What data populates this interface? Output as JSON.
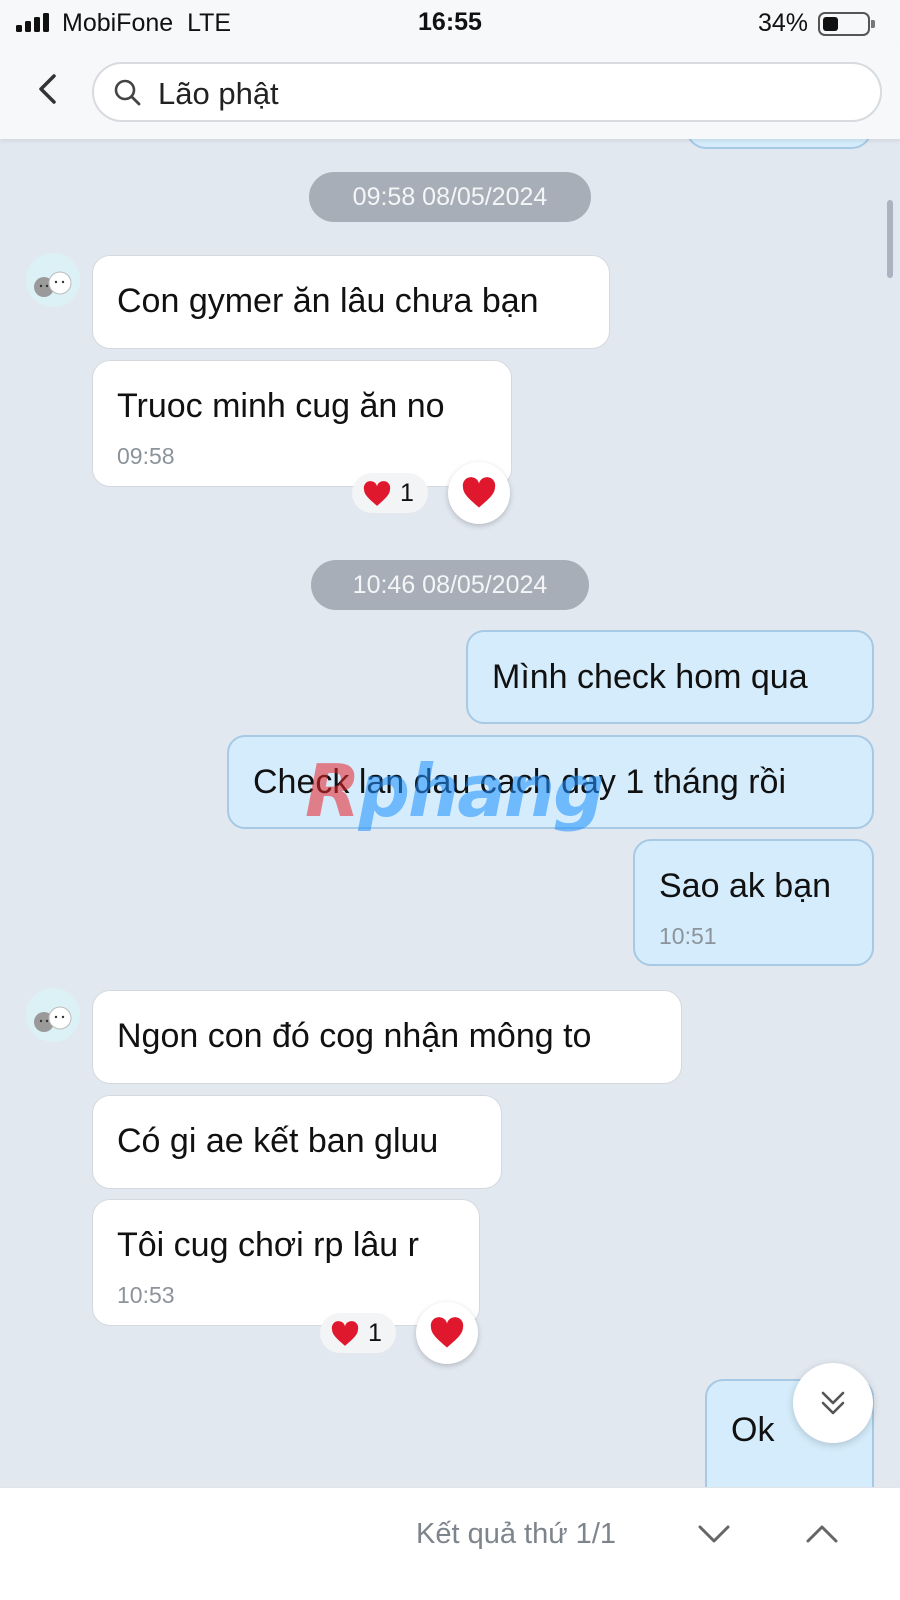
{
  "status_bar": {
    "carrier": "MobiFone",
    "network": "LTE",
    "time": "16:55",
    "battery_percent": "34%",
    "battery_level": 0.34
  },
  "search": {
    "query": "Lão phật",
    "icon": "search-icon",
    "back_icon": "chevron-left-icon"
  },
  "messages": {
    "group1": {
      "timestamp": "09:58 08/05/2024",
      "m1": {
        "text": "Con gymer ăn lâu chưa bạn"
      },
      "m2": {
        "text": "Truoc minh cug ăn no",
        "time": "09:58",
        "reaction_count": "1"
      }
    },
    "group2": {
      "timestamp": "10:46 08/05/2024",
      "m3": {
        "text": "Mình check hom qua"
      },
      "m4": {
        "text": "Check lan dau cach day 1 tháng rồi"
      },
      "m5": {
        "text": "Sao ak bạn",
        "time": "10:51"
      }
    },
    "group3": {
      "m6": {
        "text": "Ngon con đó cog nhận mông to"
      },
      "m7": {
        "text": "Có gi ae kết ban gluu"
      },
      "m8": {
        "text": "Tôi cug chơi rp lâu r",
        "time": "10:53",
        "reaction_count": "1"
      }
    },
    "last": {
      "text": "Ok"
    }
  },
  "watermark": {
    "part1": "R",
    "part2": "phang"
  },
  "bottom_bar": {
    "result_text": "Kết quả thứ 1/1"
  },
  "colors": {
    "chat_background": "#e2e8f0",
    "incoming_bubble": "#ffffff",
    "outgoing_bubble": "#d4ecfb",
    "outgoing_border": "#a7c9e4",
    "timestamp_pill": "#a8aeb7",
    "heart": "#e0182d"
  }
}
